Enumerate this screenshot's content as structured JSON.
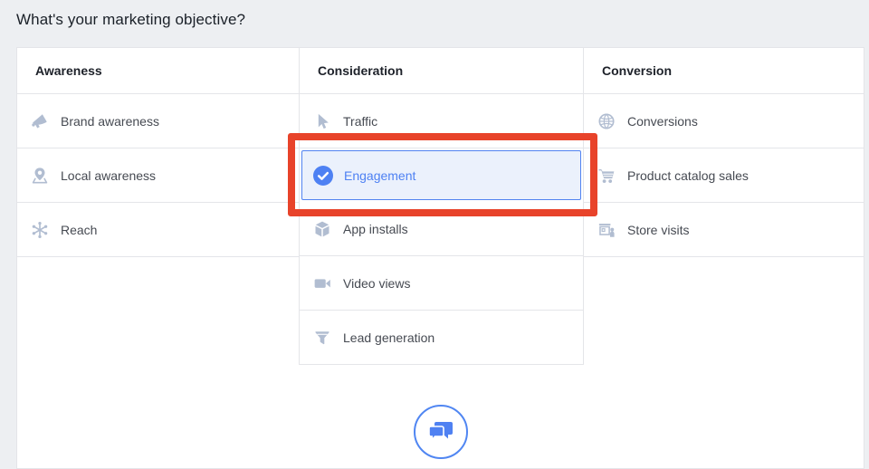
{
  "page": {
    "title": "What's your marketing objective?"
  },
  "columns": [
    {
      "header": "Awareness",
      "items": [
        {
          "label": "Brand awareness",
          "icon": "megaphone-icon",
          "selected": false
        },
        {
          "label": "Local awareness",
          "icon": "map-pin-icon",
          "selected": false
        },
        {
          "label": "Reach",
          "icon": "reach-network-icon",
          "selected": false
        }
      ]
    },
    {
      "header": "Consideration",
      "items": [
        {
          "label": "Traffic",
          "icon": "cursor-icon",
          "selected": false
        },
        {
          "label": "Engagement",
          "icon": "check-circle-icon",
          "selected": true,
          "annotated": true
        },
        {
          "label": "App installs",
          "icon": "cube-icon",
          "selected": false
        },
        {
          "label": "Video views",
          "icon": "video-camera-icon",
          "selected": false
        },
        {
          "label": "Lead generation",
          "icon": "funnel-icon",
          "selected": false
        }
      ]
    },
    {
      "header": "Conversion",
      "items": [
        {
          "label": "Conversions",
          "icon": "globe-icon",
          "selected": false
        },
        {
          "label": "Product catalog sales",
          "icon": "shopping-cart-icon",
          "selected": false
        },
        {
          "label": "Store visits",
          "icon": "storefront-icon",
          "selected": false
        }
      ]
    }
  ],
  "annotation": {
    "target_label": "Engagement",
    "color": "#e8432a"
  },
  "footer": {
    "help_button_icon": "chat-bubbles-icon"
  },
  "colors": {
    "accent_blue": "#4e81f3",
    "selected_bg": "#ebf1fc",
    "selected_border": "#5183f1",
    "annotation_red": "#e8432a",
    "icon_gray": "#b1bdd1",
    "page_bg": "#edeff2"
  }
}
